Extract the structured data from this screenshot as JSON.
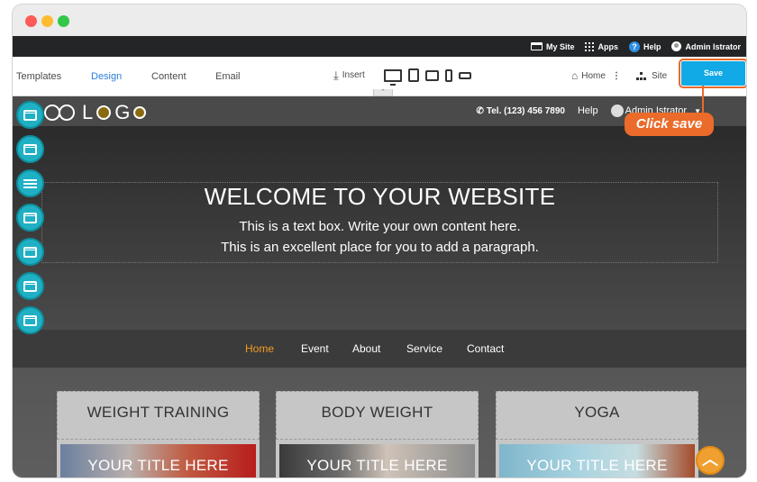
{
  "admin_bar": {
    "my_site": "My Site",
    "apps": "Apps",
    "help": "Help",
    "user": "Admin Istrator"
  },
  "toolbar": {
    "tabs": [
      "Templates",
      "Design",
      "Content",
      "Email"
    ],
    "insert": "Insert",
    "home": "Home",
    "site": "Site",
    "save": "Save"
  },
  "callout": "Click save",
  "site": {
    "logo": [
      "L",
      "G"
    ],
    "tel": "Tel. (123) 456 7890",
    "help": "Help",
    "user": "Admin Istrator",
    "hero_title": "WELCOME TO YOUR WEBSITE",
    "hero_line1": "This is a text box. Write your own content here.",
    "hero_line2": "This is an excellent place for you to add a paragraph.",
    "nav": [
      "Home",
      "Event",
      "About",
      "Service",
      "Contact"
    ],
    "cards": [
      {
        "title": "WEIGHT TRAINING",
        "image_title": "YOUR TITLE HERE"
      },
      {
        "title": "BODY WEIGHT",
        "image_title": "YOUR TITLE HERE"
      },
      {
        "title": "YOGA",
        "image_title": "YOUR TITLE HERE"
      }
    ]
  },
  "colors": {
    "accent_blue": "#11a9e6",
    "callout_orange": "#ea6b2a",
    "nav_active": "#f39c1f",
    "tool_teal": "#1fb0c4"
  }
}
